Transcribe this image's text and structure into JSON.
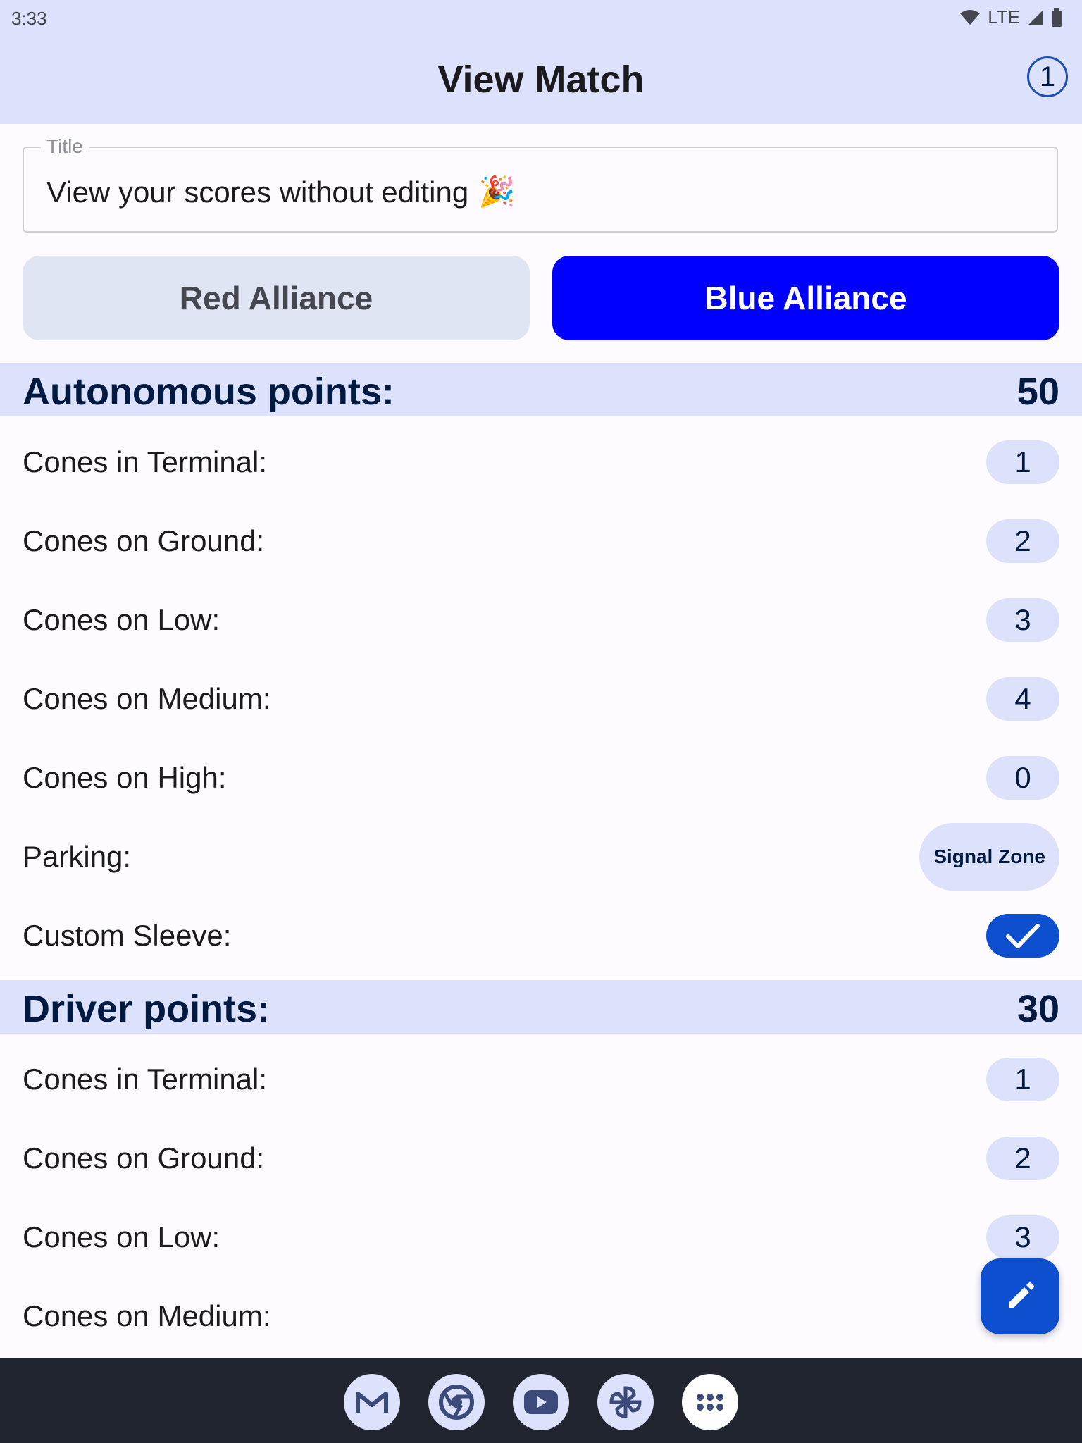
{
  "status_bar": {
    "time": "3:33",
    "network": "LTE"
  },
  "header": {
    "title": "View Match",
    "badge_count": "1"
  },
  "title_field": {
    "label": "Title",
    "value": "View your scores without editing",
    "emoji": "🎉"
  },
  "alliance_toggle": {
    "red_label": "Red Alliance",
    "blue_label": "Blue Alliance",
    "selected": "blue",
    "colors": {
      "selected_bg": "#0000ff",
      "unselected_bg": "#e0e5f3"
    }
  },
  "autonomous": {
    "label": "Autonomous points:",
    "total": "50",
    "rows": [
      {
        "label": "Cones in Terminal:",
        "value": "1"
      },
      {
        "label": "Cones on Ground:",
        "value": "2"
      },
      {
        "label": "Cones on Low:",
        "value": "3"
      },
      {
        "label": "Cones on Medium:",
        "value": "4"
      },
      {
        "label": "Cones on High:",
        "value": "0"
      },
      {
        "label": "Parking:",
        "value": "Signal Zone"
      },
      {
        "label": "Custom Sleeve:",
        "checked": true
      }
    ]
  },
  "driver": {
    "label": "Driver points:",
    "total": "30",
    "rows": [
      {
        "label": "Cones in Terminal:",
        "value": "1"
      },
      {
        "label": "Cones on Ground:",
        "value": "2"
      },
      {
        "label": "Cones on Low:",
        "value": "3"
      },
      {
        "label": "Cones on Medium:"
      }
    ]
  },
  "fab": {
    "icon": "edit-pencil-icon"
  },
  "dock": {
    "icons": [
      "gmail-icon",
      "chrome-icon",
      "youtube-icon",
      "photos-icon",
      "app-drawer-icon"
    ]
  }
}
